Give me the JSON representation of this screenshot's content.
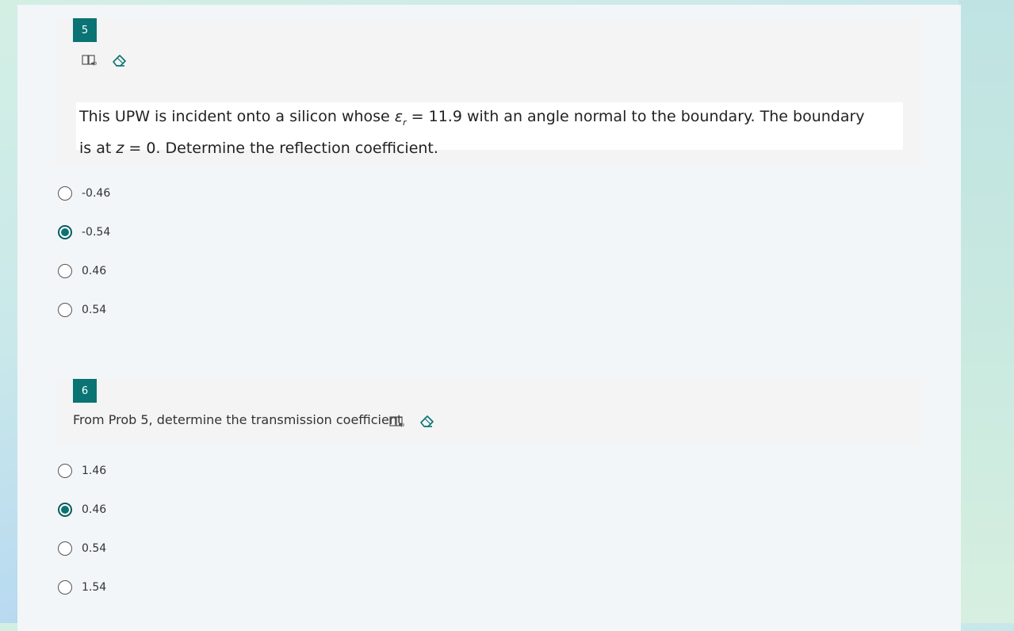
{
  "questions": [
    {
      "number": "5",
      "text_part1": "This UPW is incident onto a silicon whose ",
      "epsilon": "ε",
      "epsilon_sub": "r",
      "text_part2": " = 11.9 with an angle normal to the boundary. The boundary",
      "text_line2_a": "is at ",
      "text_line2_z": "z",
      "text_line2_b": " = 0.  Determine the reflection coefficient.",
      "options": [
        {
          "label": "-0.46",
          "selected": false
        },
        {
          "label": "-0.54",
          "selected": true
        },
        {
          "label": "0.46",
          "selected": false
        },
        {
          "label": "0.54",
          "selected": false
        }
      ]
    },
    {
      "number": "6",
      "text": "From Prob 5, determine the transmission coefficient",
      "options": [
        {
          "label": "1.46",
          "selected": false
        },
        {
          "label": "0.46",
          "selected": true
        },
        {
          "label": "0.54",
          "selected": false
        },
        {
          "label": "1.54",
          "selected": false
        }
      ]
    }
  ],
  "icons": {
    "immersive_reader": "immersive-reader-icon",
    "eraser": "eraser-icon"
  },
  "colors": {
    "accent": "#0a7373"
  }
}
